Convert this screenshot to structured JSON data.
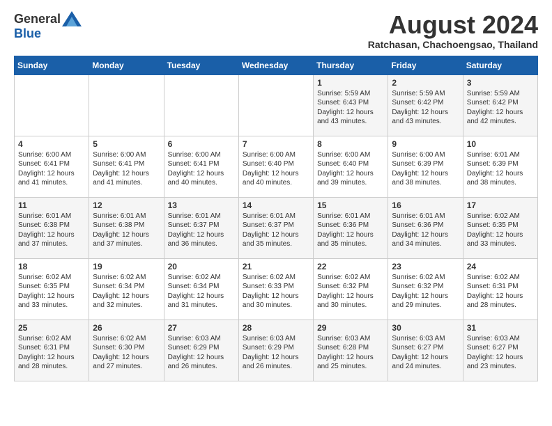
{
  "logo": {
    "general": "General",
    "blue": "Blue"
  },
  "title": "August 2024",
  "location": "Ratchasan, Chachoengsao, Thailand",
  "days_of_week": [
    "Sunday",
    "Monday",
    "Tuesday",
    "Wednesday",
    "Thursday",
    "Friday",
    "Saturday"
  ],
  "weeks": [
    [
      {
        "day": "",
        "info": ""
      },
      {
        "day": "",
        "info": ""
      },
      {
        "day": "",
        "info": ""
      },
      {
        "day": "",
        "info": ""
      },
      {
        "day": "1",
        "info": "Sunrise: 5:59 AM\nSunset: 6:43 PM\nDaylight: 12 hours\nand 43 minutes."
      },
      {
        "day": "2",
        "info": "Sunrise: 5:59 AM\nSunset: 6:42 PM\nDaylight: 12 hours\nand 43 minutes."
      },
      {
        "day": "3",
        "info": "Sunrise: 5:59 AM\nSunset: 6:42 PM\nDaylight: 12 hours\nand 42 minutes."
      }
    ],
    [
      {
        "day": "4",
        "info": "Sunrise: 6:00 AM\nSunset: 6:41 PM\nDaylight: 12 hours\nand 41 minutes."
      },
      {
        "day": "5",
        "info": "Sunrise: 6:00 AM\nSunset: 6:41 PM\nDaylight: 12 hours\nand 41 minutes."
      },
      {
        "day": "6",
        "info": "Sunrise: 6:00 AM\nSunset: 6:41 PM\nDaylight: 12 hours\nand 40 minutes."
      },
      {
        "day": "7",
        "info": "Sunrise: 6:00 AM\nSunset: 6:40 PM\nDaylight: 12 hours\nand 40 minutes."
      },
      {
        "day": "8",
        "info": "Sunrise: 6:00 AM\nSunset: 6:40 PM\nDaylight: 12 hours\nand 39 minutes."
      },
      {
        "day": "9",
        "info": "Sunrise: 6:00 AM\nSunset: 6:39 PM\nDaylight: 12 hours\nand 38 minutes."
      },
      {
        "day": "10",
        "info": "Sunrise: 6:01 AM\nSunset: 6:39 PM\nDaylight: 12 hours\nand 38 minutes."
      }
    ],
    [
      {
        "day": "11",
        "info": "Sunrise: 6:01 AM\nSunset: 6:38 PM\nDaylight: 12 hours\nand 37 minutes."
      },
      {
        "day": "12",
        "info": "Sunrise: 6:01 AM\nSunset: 6:38 PM\nDaylight: 12 hours\nand 37 minutes."
      },
      {
        "day": "13",
        "info": "Sunrise: 6:01 AM\nSunset: 6:37 PM\nDaylight: 12 hours\nand 36 minutes."
      },
      {
        "day": "14",
        "info": "Sunrise: 6:01 AM\nSunset: 6:37 PM\nDaylight: 12 hours\nand 35 minutes."
      },
      {
        "day": "15",
        "info": "Sunrise: 6:01 AM\nSunset: 6:36 PM\nDaylight: 12 hours\nand 35 minutes."
      },
      {
        "day": "16",
        "info": "Sunrise: 6:01 AM\nSunset: 6:36 PM\nDaylight: 12 hours\nand 34 minutes."
      },
      {
        "day": "17",
        "info": "Sunrise: 6:02 AM\nSunset: 6:35 PM\nDaylight: 12 hours\nand 33 minutes."
      }
    ],
    [
      {
        "day": "18",
        "info": "Sunrise: 6:02 AM\nSunset: 6:35 PM\nDaylight: 12 hours\nand 33 minutes."
      },
      {
        "day": "19",
        "info": "Sunrise: 6:02 AM\nSunset: 6:34 PM\nDaylight: 12 hours\nand 32 minutes."
      },
      {
        "day": "20",
        "info": "Sunrise: 6:02 AM\nSunset: 6:34 PM\nDaylight: 12 hours\nand 31 minutes."
      },
      {
        "day": "21",
        "info": "Sunrise: 6:02 AM\nSunset: 6:33 PM\nDaylight: 12 hours\nand 30 minutes."
      },
      {
        "day": "22",
        "info": "Sunrise: 6:02 AM\nSunset: 6:32 PM\nDaylight: 12 hours\nand 30 minutes."
      },
      {
        "day": "23",
        "info": "Sunrise: 6:02 AM\nSunset: 6:32 PM\nDaylight: 12 hours\nand 29 minutes."
      },
      {
        "day": "24",
        "info": "Sunrise: 6:02 AM\nSunset: 6:31 PM\nDaylight: 12 hours\nand 28 minutes."
      }
    ],
    [
      {
        "day": "25",
        "info": "Sunrise: 6:02 AM\nSunset: 6:31 PM\nDaylight: 12 hours\nand 28 minutes."
      },
      {
        "day": "26",
        "info": "Sunrise: 6:02 AM\nSunset: 6:30 PM\nDaylight: 12 hours\nand 27 minutes."
      },
      {
        "day": "27",
        "info": "Sunrise: 6:03 AM\nSunset: 6:29 PM\nDaylight: 12 hours\nand 26 minutes."
      },
      {
        "day": "28",
        "info": "Sunrise: 6:03 AM\nSunset: 6:29 PM\nDaylight: 12 hours\nand 26 minutes."
      },
      {
        "day": "29",
        "info": "Sunrise: 6:03 AM\nSunset: 6:28 PM\nDaylight: 12 hours\nand 25 minutes."
      },
      {
        "day": "30",
        "info": "Sunrise: 6:03 AM\nSunset: 6:27 PM\nDaylight: 12 hours\nand 24 minutes."
      },
      {
        "day": "31",
        "info": "Sunrise: 6:03 AM\nSunset: 6:27 PM\nDaylight: 12 hours\nand 23 minutes."
      }
    ]
  ]
}
